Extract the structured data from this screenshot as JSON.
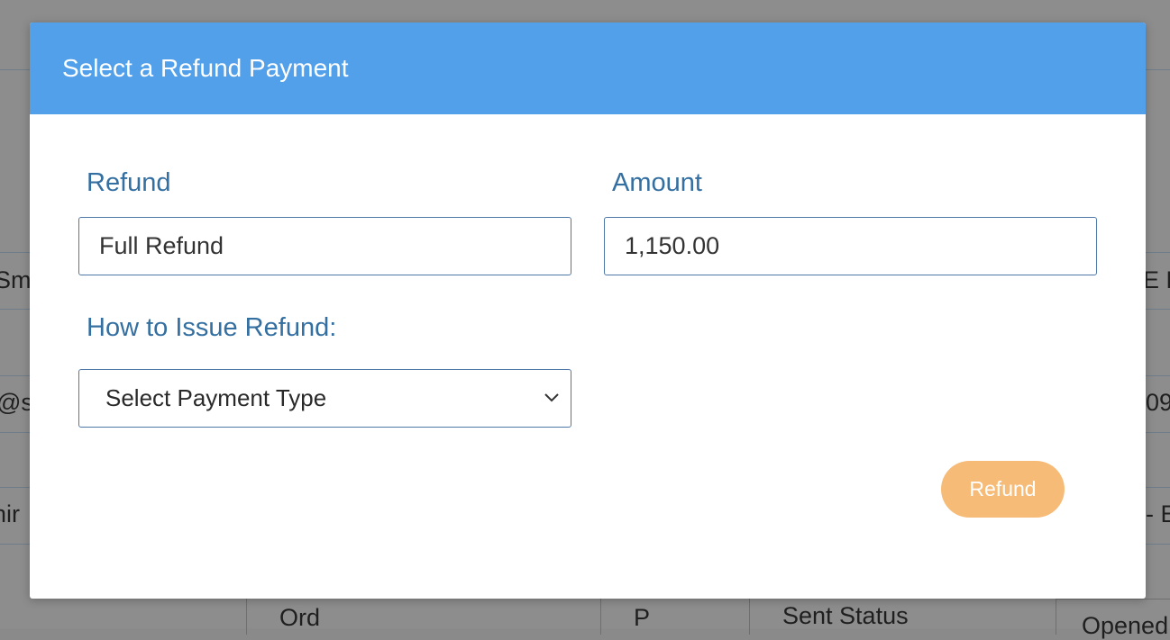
{
  "background": {
    "fragments": [
      "Sm",
      "E E",
      "@sp",
      "09",
      "hir",
      "- E"
    ],
    "table_headers": [
      "Ord",
      "P",
      "Sent Status",
      "Opened"
    ]
  },
  "modal": {
    "title": "Select a Refund Payment",
    "refund_label": "Refund",
    "refund_value": "Full Refund",
    "amount_label": "Amount",
    "amount_value": "1,150.00",
    "issue_label": "How to Issue Refund:",
    "payment_type_selected": "Select Payment Type",
    "refund_button": "Refund"
  },
  "colors": {
    "header": "#529fea",
    "label": "#346fa1",
    "button": "#f7bb78"
  }
}
